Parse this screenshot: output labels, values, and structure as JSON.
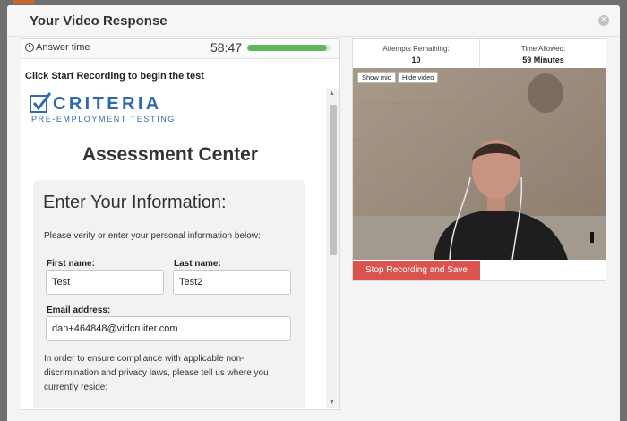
{
  "modal": {
    "title": "Your Video Response",
    "close_icon": "close-icon"
  },
  "answer_bar": {
    "icon": "clock-icon",
    "label": "Answer time",
    "time": "58:47",
    "progress_fraction": 0.95,
    "progress_color": "#5cb85c"
  },
  "instruction": "Click Start Recording to begin the test",
  "assessment": {
    "logo_word": "CRITERIA",
    "logo_sub": "PRE-EMPLOYMENT TESTING",
    "logo_color": "#2d6ab2",
    "title": "Assessment Center",
    "form": {
      "heading": "Enter Your Information:",
      "description": "Please verify or enter your personal information below:",
      "first_name_label": "First name:",
      "first_name_value": "Test",
      "last_name_label": "Last name:",
      "last_name_value": "Test2",
      "email_label": "Email address:",
      "email_value": "dan+464848@vidcruiter.com",
      "compliance_text": "In order to ensure compliance with applicable non-discrimination and privacy laws, please tell us where you currently reside:"
    }
  },
  "recording": {
    "attempts_label": "Attempts Remaining:",
    "attempts_value": "10",
    "time_allowed_label": "Time Allowed:",
    "time_allowed_value": "59 Minutes",
    "show_mic_label": "Show mic",
    "hide_video_label": "Hide video",
    "stop_button_label": "Stop Recording and Save",
    "stop_button_color": "#d9534f",
    "mic_icon": "mic-level-icon"
  }
}
